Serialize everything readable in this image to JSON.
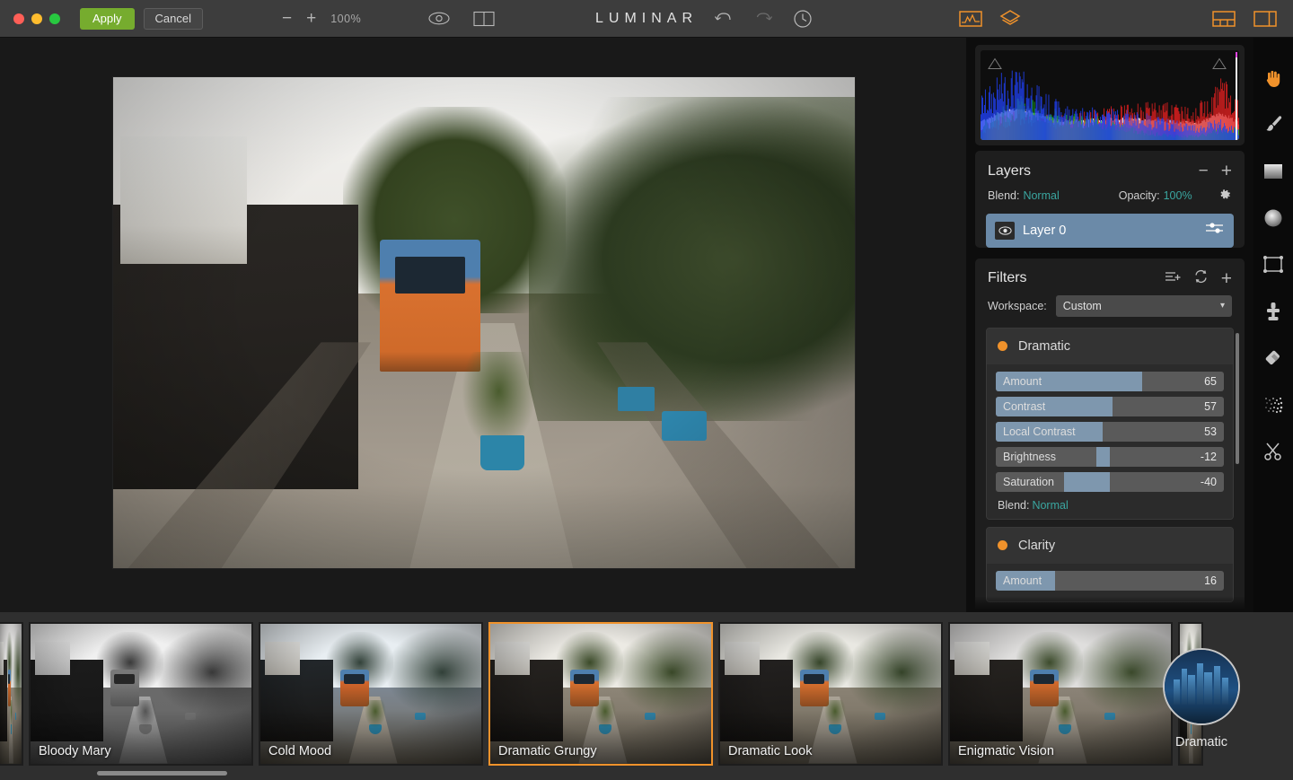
{
  "window": {
    "traffic_lights": [
      "close",
      "minimize",
      "maximize"
    ],
    "apply_label": "Apply",
    "cancel_label": "Cancel",
    "app_title": "LUMINAR"
  },
  "toolbar_top": {
    "zoom_out_label": "−",
    "zoom_in_label": "+",
    "zoom_level": "100%",
    "icons": [
      {
        "name": "eye-preview-icon",
        "label": "Preview"
      },
      {
        "name": "compare-split-icon",
        "label": "Compare"
      },
      {
        "name": "undo-icon",
        "label": "Undo"
      },
      {
        "name": "redo-icon",
        "label": "Redo"
      },
      {
        "name": "history-icon",
        "label": "History"
      },
      {
        "name": "histogram-toggle-icon",
        "label": "Histogram"
      },
      {
        "name": "layers-toggle-icon",
        "label": "Layers"
      },
      {
        "name": "filmstrip-toggle-icon",
        "label": "Presets"
      },
      {
        "name": "sidepanel-toggle-icon",
        "label": "Side Panel"
      }
    ],
    "accent": "#f0922b"
  },
  "histogram": {
    "title": "Histogram",
    "clip_left_name": "shadow-clipping-indicator",
    "clip_right_name": "highlight-clipping-indicator"
  },
  "layers": {
    "title": "Layers",
    "remove_label": "−",
    "add_label": "+",
    "blend_label": "Blend:",
    "blend_value": "Normal",
    "opacity_label": "Opacity:",
    "opacity_value": "100%",
    "items": [
      {
        "name": "Layer 0",
        "visible": true,
        "selected": true
      }
    ],
    "selected_color": "#6b8aa8",
    "value_color": "#3aa6a0"
  },
  "filters": {
    "title": "Filters",
    "workspace_label": "Workspace:",
    "workspace_value": "Custom",
    "workspace_options": [
      "Custom"
    ],
    "items": [
      {
        "name": "Dramatic",
        "enabled": true,
        "sliders": [
          {
            "label": "Amount",
            "value": 65,
            "pct": 64,
            "bipolar": false
          },
          {
            "label": "Contrast",
            "value": 57,
            "pct": 51,
            "bipolar": false
          },
          {
            "label": "Local Contrast",
            "value": 53,
            "pct": 47,
            "bipolar": false
          },
          {
            "label": "Brightness",
            "value": -12,
            "pct": 12,
            "bipolar": true
          },
          {
            "label": "Saturation",
            "value": -40,
            "pct": 40,
            "bipolar": true
          }
        ],
        "blend_label": "Blend:",
        "blend_value": "Normal"
      },
      {
        "name": "Clarity",
        "enabled": true,
        "sliders": [
          {
            "label": "Amount",
            "value": 16,
            "pct": 26,
            "bipolar": false
          }
        ]
      }
    ]
  },
  "tools": [
    {
      "name": "hand-pan-tool",
      "label": "Pan",
      "active": true
    },
    {
      "name": "brush-tool",
      "label": "Brush",
      "active": false
    },
    {
      "name": "gradient-mask-tool",
      "label": "Gradient Mask",
      "active": false
    },
    {
      "name": "radial-mask-tool",
      "label": "Radial Mask",
      "active": false
    },
    {
      "name": "crop-transform-tool",
      "label": "Crop",
      "active": false
    },
    {
      "name": "clone-stamp-tool",
      "label": "Clone & Stamp",
      "active": false
    },
    {
      "name": "erase-tool",
      "label": "Erase",
      "active": false
    },
    {
      "name": "denoise-tool",
      "label": "Denoise",
      "active": false
    },
    {
      "name": "cut-tool",
      "label": "Cut",
      "active": false
    }
  ],
  "presets": {
    "items": [
      {
        "label": "Bloody Mary",
        "selected": false,
        "style": "bw"
      },
      {
        "label": "Cold Mood",
        "selected": false,
        "style": "cold"
      },
      {
        "label": "Dramatic Grungy",
        "selected": true,
        "style": "grungy"
      },
      {
        "label": "Dramatic Look",
        "selected": false,
        "style": "dramatic"
      },
      {
        "label": "Enigmatic Vision",
        "selected": false,
        "style": "enigmatic"
      }
    ],
    "category": "Dramatic",
    "selected_color": "#f0922b"
  }
}
